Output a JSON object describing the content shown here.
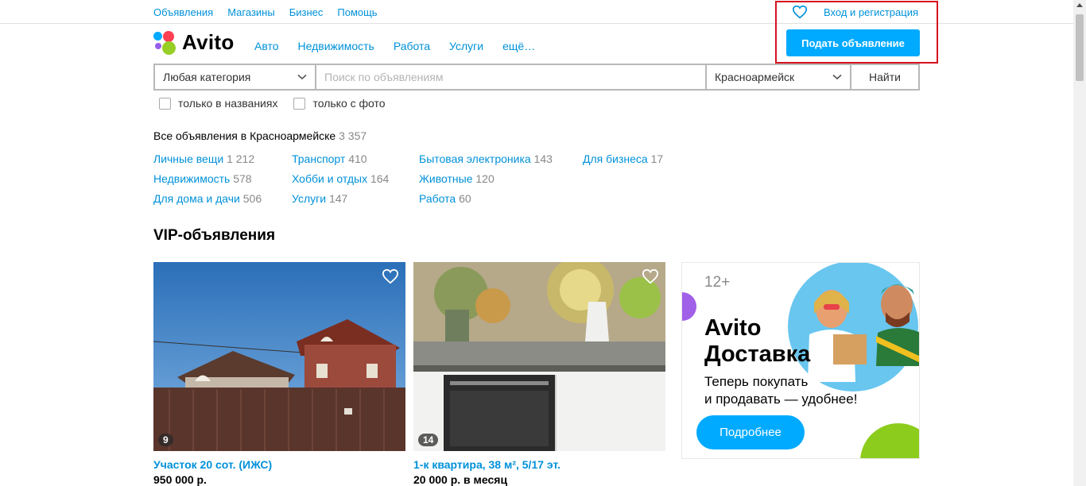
{
  "topnav": {
    "items": [
      "Объявления",
      "Магазины",
      "Бизнес",
      "Помощь"
    ],
    "login": "Вход и регистрация",
    "post_button": "Подать объявление"
  },
  "logo": {
    "text": "Avito"
  },
  "mainnav": {
    "items": [
      "Авто",
      "Недвижимость",
      "Работа",
      "Услуги",
      "ещё…"
    ]
  },
  "search": {
    "category": "Любая категория",
    "placeholder": "Поиск по объявлениям",
    "city": "Красноармейск",
    "find_button": "Найти",
    "check_titles": "только в названиях",
    "check_photo": "только с фото"
  },
  "all_ads": {
    "label": "Все объявления в Красноармейске",
    "count": "3 357"
  },
  "categories": [
    [
      {
        "name": "Личные вещи",
        "count": "1 212"
      },
      {
        "name": "Недвижимость",
        "count": "578"
      },
      {
        "name": "Для дома и дачи",
        "count": "506"
      }
    ],
    [
      {
        "name": "Транспорт",
        "count": "410"
      },
      {
        "name": "Хобби и отдых",
        "count": "164"
      },
      {
        "name": "Услуги",
        "count": "147"
      }
    ],
    [
      {
        "name": "Бытовая электроника",
        "count": "143"
      },
      {
        "name": "Животные",
        "count": "120"
      },
      {
        "name": "Работа",
        "count": "60"
      }
    ],
    [
      {
        "name": "Для бизнеса",
        "count": "17"
      }
    ]
  ],
  "vip": {
    "title": "VIP-объявления",
    "cards": [
      {
        "title": "Участок 20 сот. (ИЖС)",
        "price": "950 000 р.",
        "photos": "9"
      },
      {
        "title": "1-к квартира, 38 м², 5/17 эт.",
        "price": "20 000 р. в месяц",
        "photos": "14"
      }
    ]
  },
  "promo": {
    "age": "12+",
    "title_line1": "Avito",
    "title_line2": "Доставка",
    "text_line1": "Теперь покупать",
    "text_line2": "и продавать — удобнее!",
    "button": "Подробнее"
  },
  "colors": {
    "link": "#0091d9",
    "accent": "#00aaff",
    "highlight": "#d6121f"
  }
}
